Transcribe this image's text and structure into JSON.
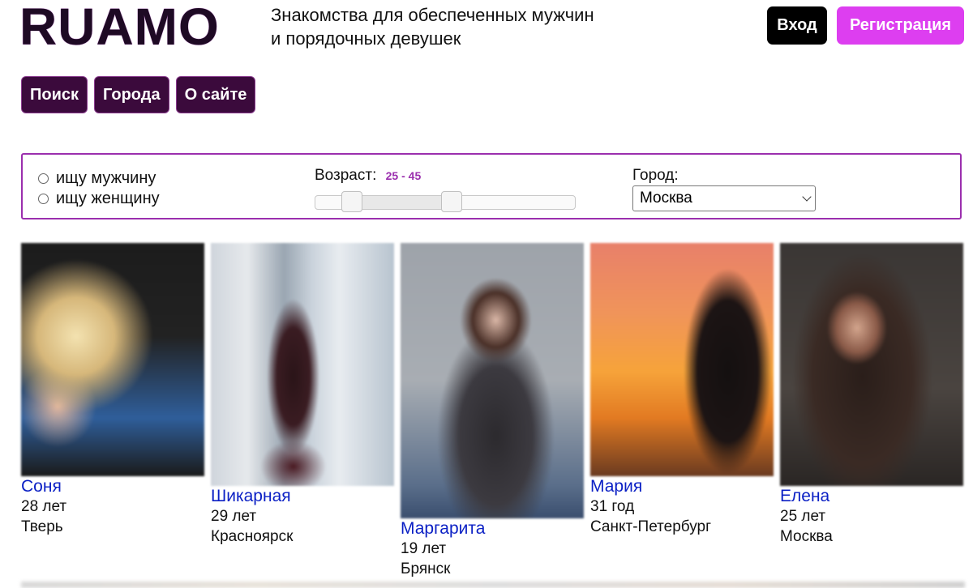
{
  "header": {
    "logo": "RUAMO",
    "tagline_line1": "Знакомства для обеспеченных мужчин",
    "tagline_line2": "и порядочных девушек",
    "login_label": "Вход",
    "register_label": "Регистрация"
  },
  "nav": {
    "items": [
      {
        "label": "Поиск"
      },
      {
        "label": "Города"
      },
      {
        "label": "О сайте"
      }
    ]
  },
  "filter": {
    "radio_man": "ищу мужчину",
    "radio_woman": "ищу женщину",
    "age_label": "Возраст:",
    "age_range": "25 - 45",
    "city_label": "Город:",
    "city_value": "Москва"
  },
  "colors": {
    "accent": "#dd3ef0",
    "nav_bg": "#3b0a3c",
    "frame": "#9b2fae",
    "link": "#0a1fc4"
  },
  "profiles": [
    {
      "name": "Соня",
      "age": "28 лет",
      "city": "Тверь"
    },
    {
      "name": "Шикарная",
      "age": "29 лет",
      "city": "Красноярск"
    },
    {
      "name": "Маргарита",
      "age": "19 лет",
      "city": "Брянск"
    },
    {
      "name": "Мария",
      "age": "31 год",
      "city": "Санкт-Петербург"
    },
    {
      "name": "Елена",
      "age": "25 лет",
      "city": "Москва"
    }
  ]
}
